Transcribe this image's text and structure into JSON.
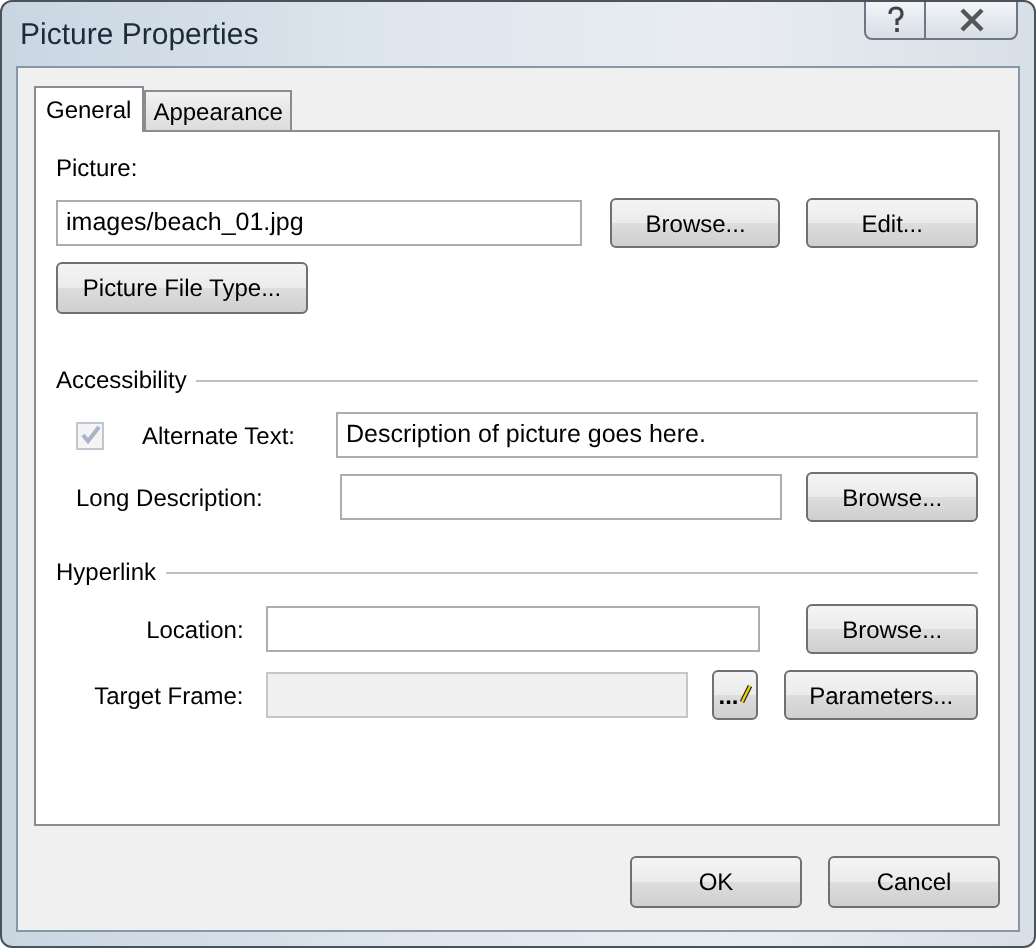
{
  "window": {
    "title": "Picture Properties"
  },
  "tabs": [
    {
      "label": "General",
      "selected": true
    },
    {
      "label": "Appearance",
      "selected": false
    }
  ],
  "picture": {
    "label": "Picture:",
    "value": "images/beach_01.jpg",
    "buttons": [
      "Browse...",
      "Edit..."
    ],
    "file_type_button": "Picture File Type..."
  },
  "accessibility": {
    "heading": "Accessibility",
    "alternate_text": {
      "checked": true,
      "disabled": true,
      "label": "Alternate Text:",
      "value": "Description of picture goes here."
    },
    "long_description": {
      "label": "Long Description:",
      "button": "Browse..."
    }
  },
  "hyperlink": {
    "heading": "Hyperlink",
    "location": {
      "label": "Location:",
      "button": "Browse..."
    },
    "target_frame": {
      "label": "Target Frame:",
      "disabled": true,
      "edit_button": "...",
      "button": "Parameters..."
    }
  },
  "buttons": [
    "OK",
    "Cancel"
  ]
}
